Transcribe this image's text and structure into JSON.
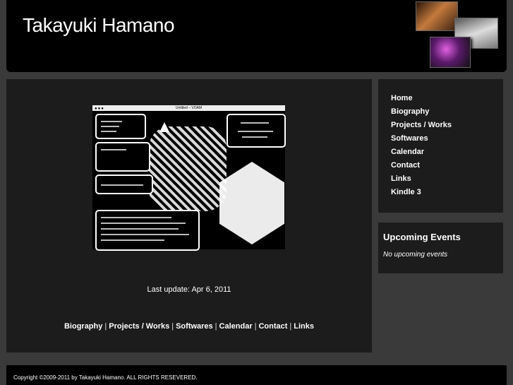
{
  "header": {
    "title": "Takayuki Hamano"
  },
  "main": {
    "last_update": "Last update: Apr 6, 2011",
    "screenshot_title": "Untitled – VOAM",
    "footer_links": [
      "Biography",
      "Projects / Works",
      "Softwares",
      "Calendar",
      "Contact",
      "Links"
    ],
    "separator": "|"
  },
  "nav": {
    "items": [
      "Home",
      "Biography",
      "Projects / Works",
      "Softwares",
      "Calendar",
      "Contact",
      "Links",
      "Kindle 3"
    ]
  },
  "events": {
    "title": "Upcoming Events",
    "empty_text": "No upcoming events"
  },
  "footer": {
    "copyright": "Copyright ©2009-2011 by Takayuki Hamano. ALL RIGHTS RESEVERED."
  }
}
